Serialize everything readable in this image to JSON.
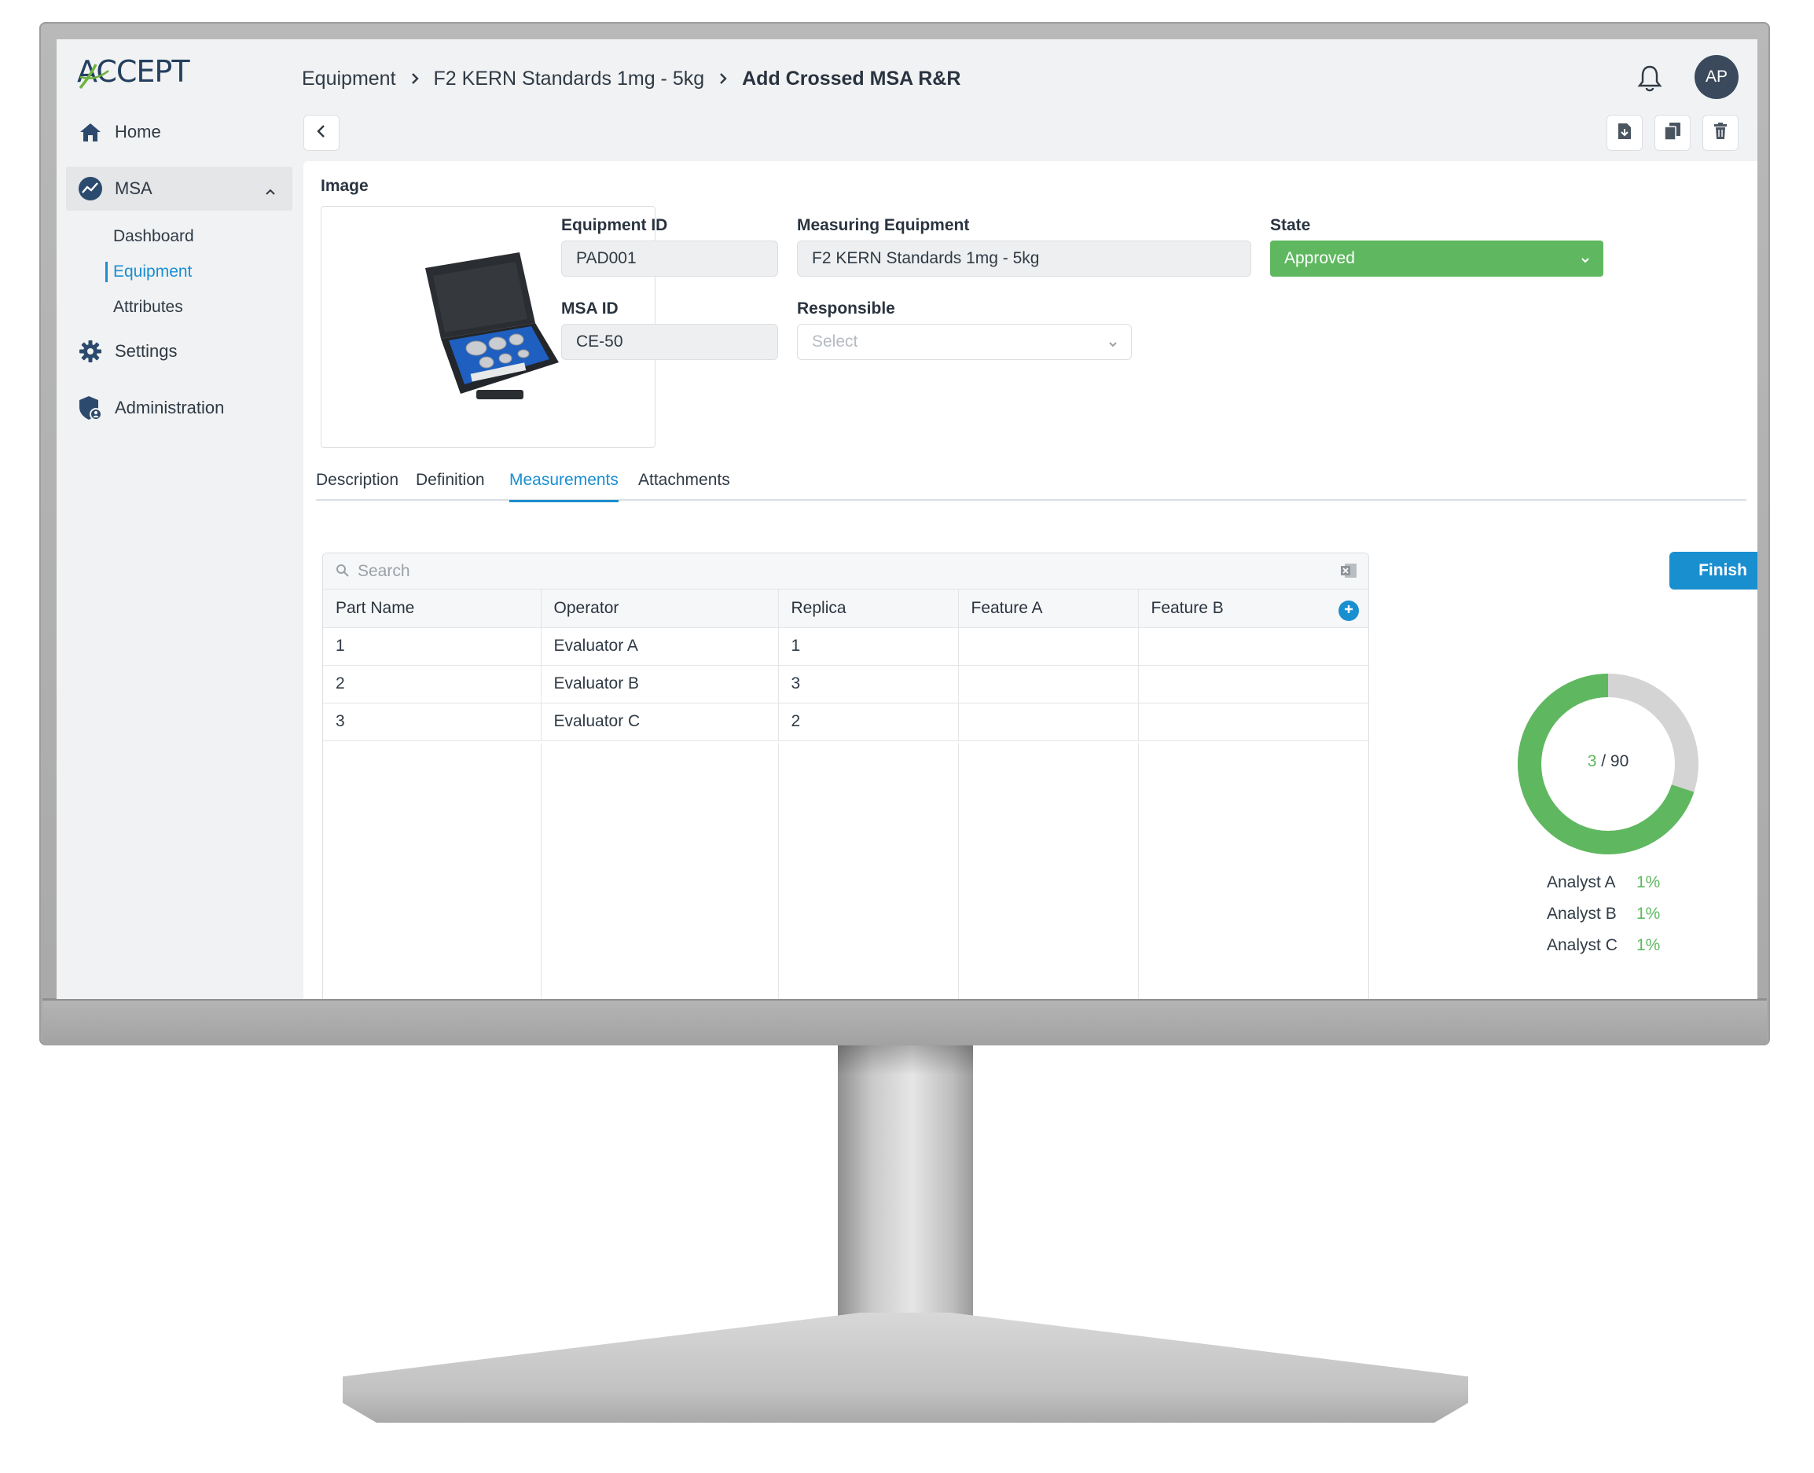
{
  "app": {
    "logo_text": "ACCEPT"
  },
  "breadcrumb": {
    "items": [
      "Equipment",
      "F2 KERN Standards 1mg - 5kg"
    ],
    "current": "Add Crossed MSA R&R"
  },
  "user": {
    "initials": "AP"
  },
  "sidebar": {
    "items": [
      {
        "label": "Home",
        "icon": "home-icon"
      },
      {
        "label": "MSA",
        "icon": "msa-chart-icon"
      },
      {
        "label": "Settings",
        "icon": "gear-icon"
      },
      {
        "label": "Administration",
        "icon": "shield-user-icon"
      }
    ],
    "msa_sub": [
      "Dashboard",
      "Equipment",
      "Attributes"
    ]
  },
  "form": {
    "image_label": "Image",
    "equipment_id_label": "Equipment ID",
    "equipment_id": "PAD001",
    "measuring_equipment_label": "Measuring Equipment",
    "measuring_equipment": "F2 KERN Standards 1mg - 5kg",
    "state_label": "State",
    "state": "Approved",
    "msa_id_label": "MSA ID",
    "msa_id": "CE-50",
    "responsible_label": "Responsible",
    "responsible_placeholder": "Select"
  },
  "tabs": [
    "Description",
    "Definition",
    "Measurements",
    "Attachments"
  ],
  "table": {
    "search_placeholder": "Search",
    "columns": [
      "Part Name",
      "Operator",
      "Replica",
      "Feature A",
      "Feature B"
    ],
    "rows": [
      [
        "1",
        "Evaluator A",
        "1",
        "",
        ""
      ],
      [
        "2",
        "Evaluator B",
        "3",
        "",
        ""
      ],
      [
        "3",
        "Evaluator C",
        "2",
        "",
        ""
      ]
    ]
  },
  "finish_label": "Finish",
  "progress": {
    "done": "3",
    "total": "/ 90",
    "fraction_complete": 0.7,
    "complete_color": "#5fb85f",
    "remaining_color": "#d4d4d4",
    "analysts": [
      {
        "name": "Analyst A",
        "pct": "1%"
      },
      {
        "name": "Analyst B",
        "pct": "1%"
      },
      {
        "name": "Analyst C",
        "pct": "1%"
      }
    ]
  }
}
